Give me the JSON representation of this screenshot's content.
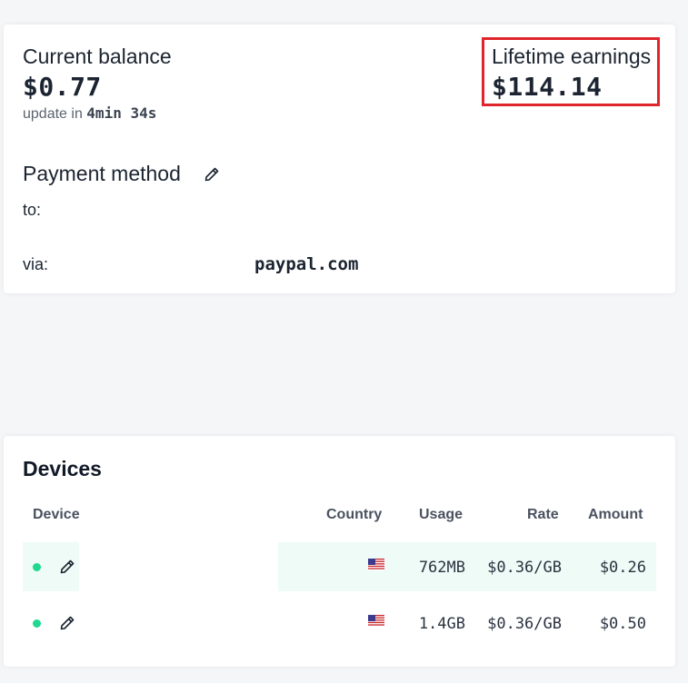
{
  "balance": {
    "current_label": "Current balance",
    "current_amount": "$0.77",
    "update_prefix": "update in",
    "update_time": "4min 34s",
    "lifetime_label": "Lifetime earnings",
    "lifetime_amount": "$114.14",
    "highlight_color": "#e0262c"
  },
  "payment": {
    "title": "Payment method",
    "to_label": "to:",
    "to_value": "",
    "via_label": "via:",
    "via_value": "paypal.com",
    "edit_icon": "pencil-icon"
  },
  "devices": {
    "title": "Devices",
    "columns": [
      "Device",
      "Country",
      "Usage",
      "Rate",
      "Amount"
    ],
    "status_color": "#1ed98f",
    "rows": [
      {
        "status": "online",
        "country_flag": "us-flag-icon",
        "usage": "762MB",
        "rate": "$0.36/GB",
        "amount": "$0.26"
      },
      {
        "status": "online",
        "country_flag": "us-flag-icon",
        "usage": "1.4GB",
        "rate": "$0.36/GB",
        "amount": "$0.50"
      }
    ]
  }
}
